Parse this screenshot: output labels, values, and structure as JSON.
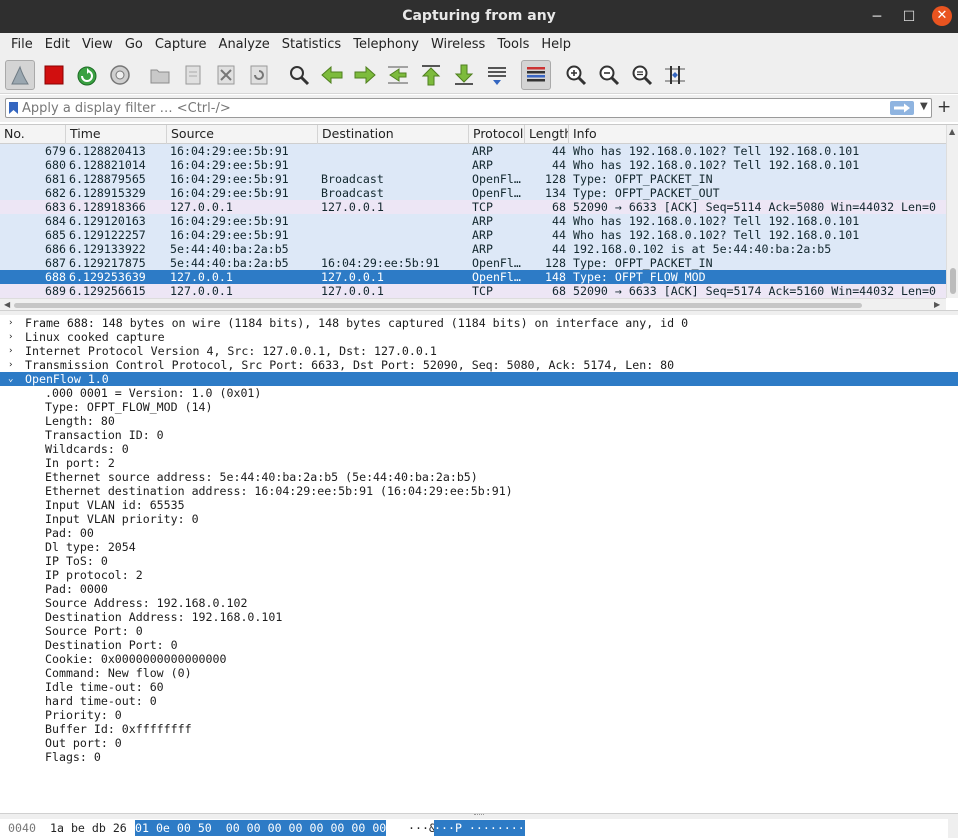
{
  "window": {
    "title": "Capturing from any",
    "minimize": "─",
    "maximize": "☐",
    "close": "✕"
  },
  "menu": [
    "File",
    "Edit",
    "View",
    "Go",
    "Capture",
    "Analyze",
    "Statistics",
    "Telephony",
    "Wireless",
    "Tools",
    "Help"
  ],
  "toolbar": {
    "icons": [
      "shark-fin-start-icon",
      "stop-capture-icon",
      "restart-capture-icon",
      "capture-options-icon",
      "open-file-icon",
      "save-file-icon",
      "close-file-icon",
      "reload-file-icon",
      "find-packet-icon",
      "go-back-icon",
      "go-forward-icon",
      "go-to-packet-icon",
      "go-first-icon",
      "go-last-icon",
      "autoscroll-icon",
      "colorize-icon",
      "zoom-in-icon",
      "zoom-out-icon",
      "zoom-normal-icon",
      "resize-columns-icon"
    ]
  },
  "filter": {
    "placeholder": "Apply a display filter … <Ctrl-/>",
    "value": ""
  },
  "packet_list": {
    "columns": [
      "No.",
      "Time",
      "Source",
      "Destination",
      "Protocol",
      "Length",
      "Info"
    ],
    "rows": [
      {
        "no": "679",
        "time": "6.128820413",
        "source": "16:04:29:ee:5b:91",
        "destination": "",
        "protocol": "ARP",
        "length": "44",
        "info": "Who has 192.168.0.102? Tell 192.168.0.101",
        "color": "#dde8f7"
      },
      {
        "no": "680",
        "time": "6.128821014",
        "source": "16:04:29:ee:5b:91",
        "destination": "",
        "protocol": "ARP",
        "length": "44",
        "info": "Who has 192.168.0.102? Tell 192.168.0.101",
        "color": "#dde8f7"
      },
      {
        "no": "681",
        "time": "6.128879565",
        "source": "16:04:29:ee:5b:91",
        "destination": "Broadcast",
        "protocol": "OpenFl…",
        "length": "128",
        "info": "Type: OFPT_PACKET_IN",
        "color": "#dde8f7"
      },
      {
        "no": "682",
        "time": "6.128915329",
        "source": "16:04:29:ee:5b:91",
        "destination": "Broadcast",
        "protocol": "OpenFl…",
        "length": "134",
        "info": "Type: OFPT_PACKET_OUT",
        "color": "#dde8f7"
      },
      {
        "no": "683",
        "time": "6.128918366",
        "source": "127.0.0.1",
        "destination": "127.0.0.1",
        "protocol": "TCP",
        "length": "68",
        "info": "52090 → 6633 [ACK] Seq=5114 Ack=5080 Win=44032 Len=0",
        "color": "#ede6f5"
      },
      {
        "no": "684",
        "time": "6.129120163",
        "source": "16:04:29:ee:5b:91",
        "destination": "",
        "protocol": "ARP",
        "length": "44",
        "info": "Who has 192.168.0.102? Tell 192.168.0.101",
        "color": "#dde8f7"
      },
      {
        "no": "685",
        "time": "6.129122257",
        "source": "16:04:29:ee:5b:91",
        "destination": "",
        "protocol": "ARP",
        "length": "44",
        "info": "Who has 192.168.0.102? Tell 192.168.0.101",
        "color": "#dde8f7"
      },
      {
        "no": "686",
        "time": "6.129133922",
        "source": "5e:44:40:ba:2a:b5",
        "destination": "",
        "protocol": "ARP",
        "length": "44",
        "info": "192.168.0.102 is at 5e:44:40:ba:2a:b5",
        "color": "#dde8f7"
      },
      {
        "no": "687",
        "time": "6.129217875",
        "source": "5e:44:40:ba:2a:b5",
        "destination": "16:04:29:ee:5b:91",
        "protocol": "OpenFl…",
        "length": "128",
        "info": "Type: OFPT_PACKET_IN",
        "color": "#dde8f7"
      },
      {
        "no": "688",
        "time": "6.129253639",
        "source": "127.0.0.1",
        "destination": "127.0.0.1",
        "protocol": "OpenFl…",
        "length": "148",
        "info": "Type: OFPT_FLOW_MOD",
        "color": "#2d7bc6",
        "selected": true
      },
      {
        "no": "689",
        "time": "6.129256615",
        "source": "127.0.0.1",
        "destination": "127.0.0.1",
        "protocol": "TCP",
        "length": "68",
        "info": "52090 → 6633 [ACK] Seq=5174 Ack=5160 Win=44032 Len=0",
        "color": "#ede6f5"
      }
    ]
  },
  "details": [
    {
      "text": "Frame 688: 148 bytes on wire (1184 bits), 148 bytes captured (1184 bits) on interface any, id 0",
      "level": 0,
      "expander": "›"
    },
    {
      "text": "Linux cooked capture",
      "level": 0,
      "expander": "›"
    },
    {
      "text": "Internet Protocol Version 4, Src: 127.0.0.1, Dst: 127.0.0.1",
      "level": 0,
      "expander": "›"
    },
    {
      "text": "Transmission Control Protocol, Src Port: 6633, Dst Port: 52090, Seq: 5080, Ack: 5174, Len: 80",
      "level": 0,
      "expander": "›"
    },
    {
      "text": "OpenFlow 1.0",
      "level": 0,
      "expander": "⌄",
      "selected": true
    },
    {
      "text": ".000 0001 = Version: 1.0 (0x01)",
      "level": 1
    },
    {
      "text": "Type: OFPT_FLOW_MOD (14)",
      "level": 1
    },
    {
      "text": "Length: 80",
      "level": 1
    },
    {
      "text": "Transaction ID: 0",
      "level": 1
    },
    {
      "text": "Wildcards: 0",
      "level": 1
    },
    {
      "text": "In port: 2",
      "level": 1
    },
    {
      "text": "Ethernet source address: 5e:44:40:ba:2a:b5 (5e:44:40:ba:2a:b5)",
      "level": 1
    },
    {
      "text": "Ethernet destination address: 16:04:29:ee:5b:91 (16:04:29:ee:5b:91)",
      "level": 1
    },
    {
      "text": "Input VLAN id: 65535",
      "level": 1
    },
    {
      "text": "Input VLAN priority: 0",
      "level": 1
    },
    {
      "text": "Pad: 00",
      "level": 1
    },
    {
      "text": "Dl type: 2054",
      "level": 1
    },
    {
      "text": "IP ToS: 0",
      "level": 1
    },
    {
      "text": "IP protocol: 2",
      "level": 1
    },
    {
      "text": "Pad: 0000",
      "level": 1
    },
    {
      "text": "Source Address: 192.168.0.102",
      "level": 1
    },
    {
      "text": "Destination Address: 192.168.0.101",
      "level": 1
    },
    {
      "text": "Source Port: 0",
      "level": 1
    },
    {
      "text": "Destination Port: 0",
      "level": 1
    },
    {
      "text": "Cookie: 0x0000000000000000",
      "level": 1
    },
    {
      "text": "Command: New flow (0)",
      "level": 1
    },
    {
      "text": "Idle time-out: 60",
      "level": 1
    },
    {
      "text": "hard time-out: 0",
      "level": 1
    },
    {
      "text": "Priority: 0",
      "level": 1
    },
    {
      "text": "Buffer Id: 0xffffffff",
      "level": 1
    },
    {
      "text": "Out port: 0",
      "level": 1
    },
    {
      "text": "Flags: 0",
      "level": 1
    }
  ],
  "bytes": {
    "offset": "0040",
    "hex_pre": "1a be db 26",
    "hex_sel": "01 0e 00 50  00 00 00 00 00 00 00 00",
    "ascii_pre": "···&",
    "ascii_sel": "···P ········"
  },
  "colors": {
    "selection": "#2d7bc6",
    "arp_row": "#dde8f7",
    "tcp_row": "#ede6f5",
    "close_button": "#e95420"
  }
}
